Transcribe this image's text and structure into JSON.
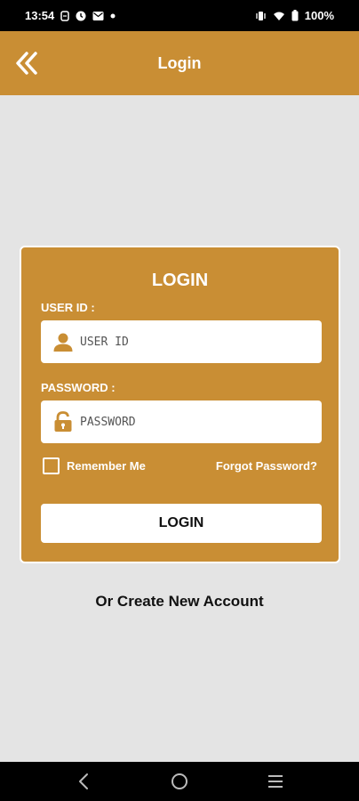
{
  "status_bar": {
    "time": "13:54",
    "battery": "100%",
    "left_icons": [
      "sim-icon",
      "clock-icon",
      "mail-icon",
      "dot-icon"
    ],
    "right_icons": [
      "vibrate-icon",
      "wifi-icon",
      "battery-icon"
    ]
  },
  "header": {
    "title": "Login",
    "back_icon": "double-chevron-left-icon"
  },
  "login_card": {
    "title": "LOGIN",
    "user_id_label": "USER ID :",
    "user_id_placeholder": "USER ID",
    "user_id_icon": "user-icon",
    "password_label": "PASSWORD :",
    "password_placeholder": "PASSWORD",
    "password_icon": "lock-icon",
    "remember_label": "Remember Me",
    "remember_checked": false,
    "forgot_label": "Forgot Password?",
    "login_button": "LOGIN"
  },
  "create_account": "Or Create New Account",
  "nav_bar": {
    "icons": [
      "back-icon",
      "home-icon",
      "recents-icon"
    ]
  },
  "colors": {
    "accent": "#c98e34",
    "background": "#e4e4e4",
    "text_dark": "#111111",
    "white": "#ffffff"
  }
}
